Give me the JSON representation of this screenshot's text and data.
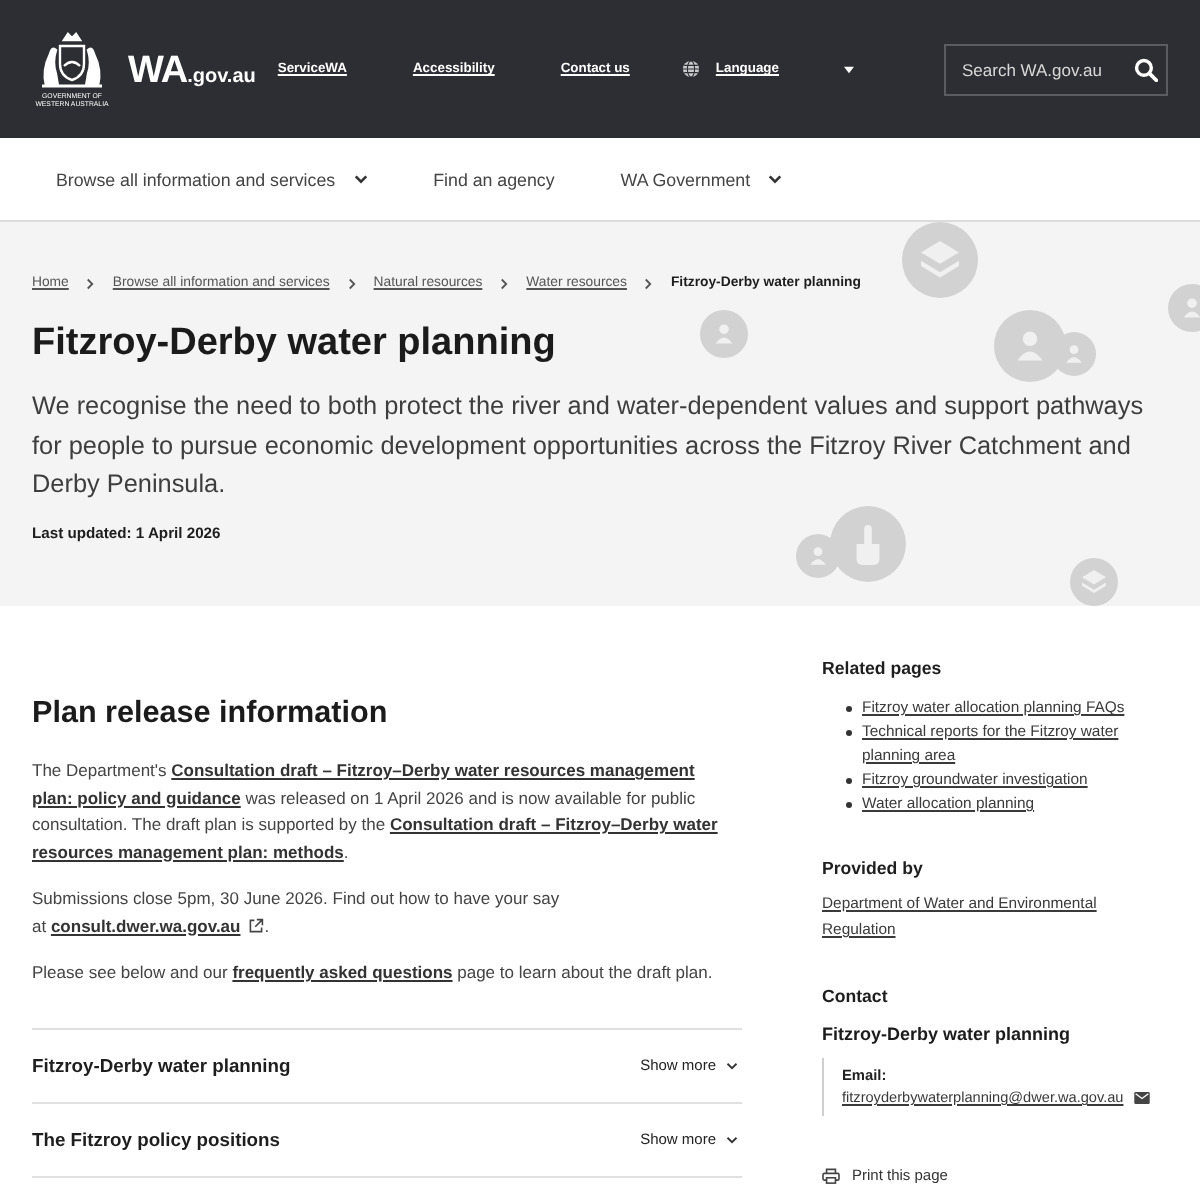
{
  "header": {
    "crest_caption": [
      "GOVERNMENT OF",
      "WESTERN AUSTRALIA"
    ],
    "logo": {
      "main": "WA",
      "suffix": ".gov.au"
    },
    "links": [
      "ServiceWA",
      "Accessibility",
      "Contact us"
    ],
    "language": "Language",
    "search": {
      "placeholder": "Search WA.gov.au"
    }
  },
  "nav": [
    {
      "label": "Browse all information and services",
      "has_menu": true
    },
    {
      "label": "Find an agency",
      "has_menu": false
    },
    {
      "label": "WA Government",
      "has_menu": true
    }
  ],
  "breadcrumb": [
    {
      "label": "Home",
      "current": false
    },
    {
      "label": "Browse all information and services",
      "current": false
    },
    {
      "label": "Natural resources",
      "current": false
    },
    {
      "label": "Water resources",
      "current": false
    },
    {
      "label": "Fitzroy-Derby water planning",
      "current": true
    }
  ],
  "hero": {
    "title": "Fitzroy-Derby water planning",
    "intro": "We recognise the need to both protect the river and water-dependent values and support pathways for people to pursue economic development opportunities across the Fitzroy River Catchment and Derby Peninsula.",
    "last_updated": "Last updated: 1 April 2026"
  },
  "main": {
    "heading": "Plan release information",
    "paragraphs": [
      [
        {
          "kind": "text",
          "text": "The Department's "
        },
        {
          "kind": "link",
          "lines": [
            "Consultation draft – Fitzroy–Derby water resources management",
            "plan: policy and guidance"
          ]
        },
        {
          "kind": "text",
          "text": " was released on 1 April 2026 and is now available for public consultation. The draft plan is supported by the "
        },
        {
          "kind": "link",
          "lines": [
            "Consultation draft – Fitzroy–Derby water",
            "resources management plan: methods"
          ]
        },
        {
          "kind": "text",
          "text": "."
        }
      ],
      [
        {
          "kind": "text",
          "text": "Submissions close 5pm, 30 June 2026. Find out how to have your say"
        },
        {
          "kind": "break"
        },
        {
          "kind": "text",
          "text": "at "
        },
        {
          "kind": "external_link",
          "lines": [
            "consult.dwer.wa.gov.au"
          ]
        },
        {
          "kind": "text",
          "text": "."
        }
      ],
      [
        {
          "kind": "text",
          "text": "Please see below and our "
        },
        {
          "kind": "link",
          "lines": [
            "frequently asked questions"
          ]
        },
        {
          "kind": "text",
          "text": " page to learn about the draft plan."
        }
      ]
    ],
    "accordion": [
      {
        "title": "Fitzroy-Derby water planning",
        "toggle": "Show more",
        "expanded": false
      },
      {
        "title": "The Fitzroy policy positions",
        "toggle": "Show more",
        "expanded": false
      }
    ]
  },
  "sidebar": {
    "related": {
      "heading": "Related pages",
      "links": [
        "Fitzroy water allocation planning FAQs",
        "Technical reports for the Fitzroy water planning area",
        "Fitzroy groundwater investigation",
        "Water allocation planning"
      ]
    },
    "provided_by": {
      "heading": "Provided by",
      "link": "Department of Water and Environmental Regulation"
    },
    "contact": {
      "heading": "Contact",
      "name": "Fitzroy-Derby water planning",
      "email_label": "Email:",
      "email": "fitzroyderbywaterplanning@dwer.wa.gov.au"
    },
    "print": "Print this page"
  }
}
